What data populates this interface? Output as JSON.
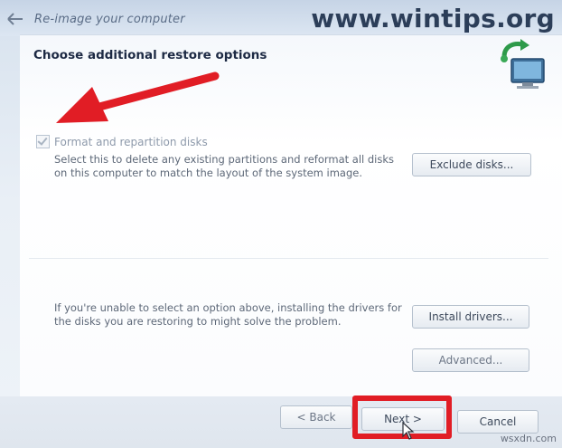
{
  "window": {
    "title": "Re-image your computer",
    "watermark": "www.wintips.org"
  },
  "page": {
    "title": "Choose additional restore options"
  },
  "format_option": {
    "label": "Format and repartition disks",
    "checked": true,
    "enabled": false,
    "description": "Select this to delete any existing partitions and reformat all disks on this computer to match the layout of the system image."
  },
  "buttons": {
    "exclude_disks": "Exclude disks...",
    "install_drivers": "Install drivers...",
    "advanced": "Advanced...",
    "back": "< Back",
    "next": "Next >",
    "cancel": "Cancel"
  },
  "drivers_hint": "If you're unable to select an option above, installing the drivers for the disks you are restoring to might solve the problem.",
  "annotations": {
    "highlight_color": "#e11d25"
  },
  "credit": "wsxdn.com",
  "icons": {
    "back": "back-arrow-icon",
    "computer": "computer-restore-icon",
    "cursor": "mouse-cursor-icon"
  }
}
